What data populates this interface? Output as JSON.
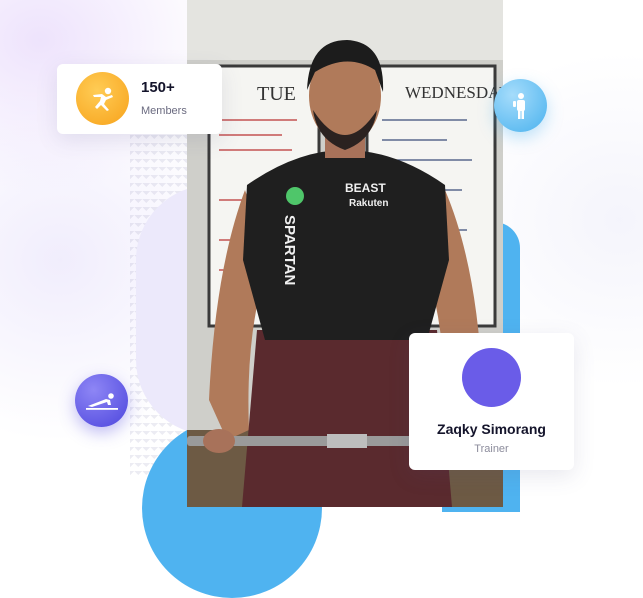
{
  "members_card": {
    "count": "150+",
    "label": "Members",
    "icon": "running-kick-icon"
  },
  "trainer_card": {
    "name": "Zaqky Simorang",
    "role": "Trainer"
  },
  "photo": {
    "icon": "trainer-weightlifting-photo",
    "board_left_heading": "TUE",
    "board_right_heading": "WEDNESDAY",
    "shirt_logo_text": "SPARTAN",
    "shirt_sponsor_line1": "BEAST",
    "shirt_sponsor_line2": "Rakuten"
  },
  "badges": {
    "top_right": "standing-person-icon",
    "bottom_left": "pushup-icon"
  },
  "colors": {
    "accent_blue": "#4fb3f0",
    "accent_purple": "#6a5ce8",
    "accent_orange": "#f7a21b",
    "text_dark": "#14142b"
  }
}
